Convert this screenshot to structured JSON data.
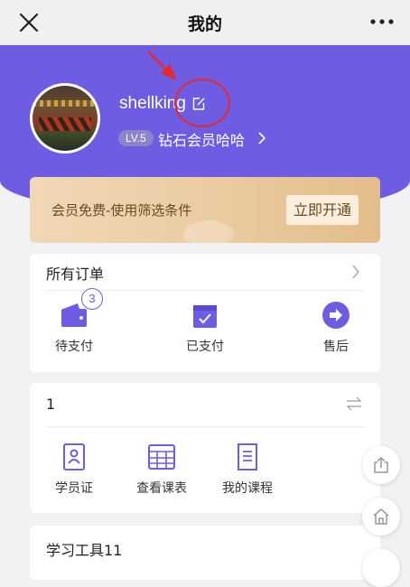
{
  "header": {
    "title": "我的"
  },
  "profile": {
    "username": "shellking",
    "level_badge": "LV.5",
    "membership_text": "钻石会员哈哈"
  },
  "vip_banner": {
    "text": "会员免费-使用筛选条件",
    "button_label": "立即开通"
  },
  "orders": {
    "title": "所有订单",
    "items": [
      {
        "label": "待支付",
        "icon": "wallet-icon",
        "badge": "3"
      },
      {
        "label": "已支付",
        "icon": "calendar-check-icon"
      },
      {
        "label": "售后",
        "icon": "after-sale-arrow-icon"
      }
    ]
  },
  "section2": {
    "title": "1",
    "items": [
      {
        "label": "学员证",
        "icon": "student-id-icon"
      },
      {
        "label": "查看课表",
        "icon": "timetable-icon"
      },
      {
        "label": "我的课程",
        "icon": "course-book-icon"
      }
    ]
  },
  "section3": {
    "title": "学习工具11"
  },
  "floating": {
    "share_icon": "share-icon",
    "home_icon": "home-icon"
  },
  "colors": {
    "accent": "#6e5de3",
    "annotation_red": "#e8282b",
    "vip_gold": "#eccda4",
    "background": "#f2f2f4"
  }
}
